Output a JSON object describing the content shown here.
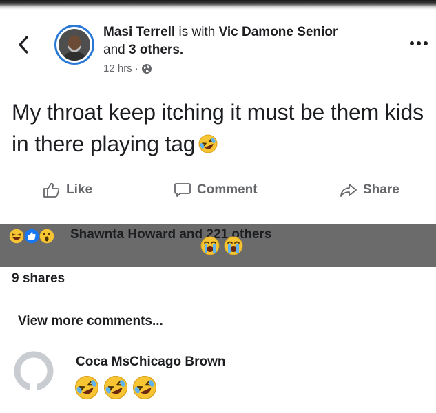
{
  "post": {
    "author": "Masi Terrell",
    "with_word": "is with",
    "tagged": "Vic Damone Senior",
    "and_word": "and",
    "others": "3 others.",
    "time": "12 hrs",
    "time_separator": "·",
    "privacy_icon": "globe-icon",
    "text": "My throat keep itching it must be them kids in there playing tag",
    "text_emoji": "rofl-emoji"
  },
  "actions": {
    "like": "Like",
    "comment": "Comment",
    "share": "Share"
  },
  "reactions": {
    "icons": [
      "haha-icon",
      "like-icon",
      "wow-icon"
    ],
    "summary": "Shawnta Howard and 221 others",
    "overlay_emojis": [
      "loudly-crying-emoji",
      "loudly-crying-emoji"
    ]
  },
  "shares_count": "9 shares",
  "comments": {
    "view_more": "View more comments...",
    "items": [
      {
        "author": "Coca MsChicago Brown",
        "emojis": [
          "rofl-emoji",
          "rofl-emoji",
          "rofl-emoji"
        ]
      }
    ]
  },
  "colors": {
    "accent_blue": "#2a78d6",
    "secondary_text": "#65676b",
    "overlay_band": "#6b6b6b",
    "emoji_yellow": "#f7c533"
  }
}
